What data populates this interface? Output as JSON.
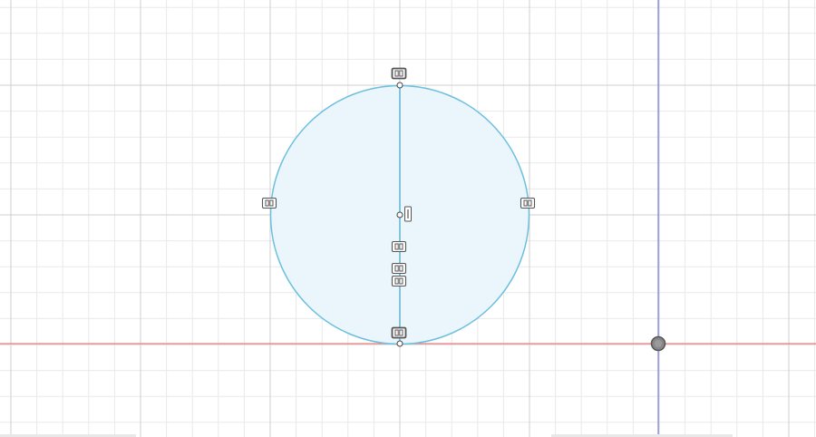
{
  "viewport": {
    "background_color": "#ffffff",
    "minor_grid_color": "#e9e9e9",
    "major_grid_color": "#cfcfcf",
    "x_axis_color": "#f08080",
    "y_axis_color": "#8080e0"
  },
  "sketch": {
    "profile_fill_color": "#eaf5fc",
    "curve_color": "#6cc0de",
    "construction_line_color": "#5aaed0",
    "constraint_glyph_color": "#555555",
    "point_color": "#444444"
  },
  "origin_marker_color": "#888888",
  "icons": {
    "coincident_constraint": "coincident-constraint-icon",
    "horizontal_constraint": "horizontal-constraint-icon",
    "vertical_constraint": "vertical-constraint-icon",
    "origin": "origin-point-icon"
  }
}
